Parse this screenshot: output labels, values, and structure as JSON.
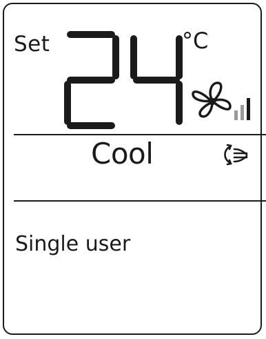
{
  "display": {
    "set_label": "Set",
    "temperature": "24",
    "unit": "°C",
    "mode": "Cool",
    "user_mode": "Single user"
  },
  "icons": {
    "fan": "fan-speed-icon",
    "swing": "air-swing-icon"
  },
  "colors": {
    "segment": "#1a1a1a",
    "background": "#ffffff"
  }
}
